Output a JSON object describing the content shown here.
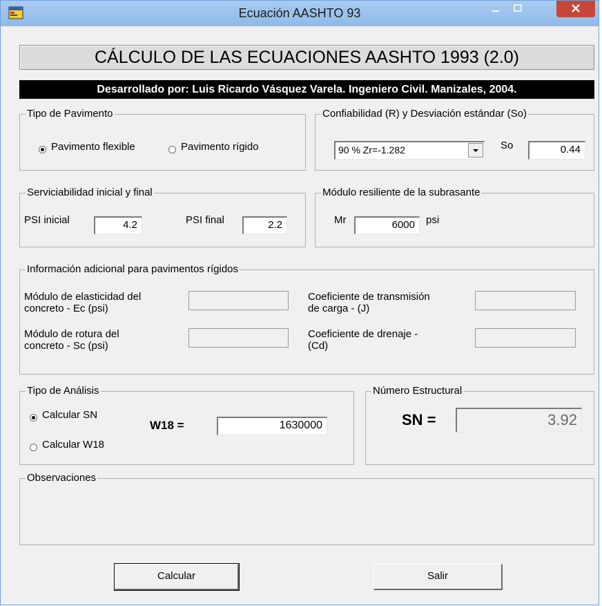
{
  "window": {
    "title": "Ecuación AASHTO 93"
  },
  "header": {
    "main_title": "CÁLCULO DE LAS ECUACIONES AASHTO 1993 (2.0)",
    "credit": "Desarrollado por: Luis Ricardo Vásquez Varela.  Ingeniero Civil. Manizales, 2004."
  },
  "pavement_type": {
    "legend": "Tipo de Pavimento",
    "flexible": "Pavimento flexible",
    "rigid": "Pavimento rígido",
    "selected": "flexible"
  },
  "reliability": {
    "legend": "Confiabilidad (R) y Desviación estándar (So)",
    "selected": "90 %  Zr=-1.282",
    "so_label": "So",
    "so_value": "0.44"
  },
  "serviceability": {
    "legend": "Serviciabilidad inicial y final",
    "psi_initial_label": "PSI inicial",
    "psi_initial_value": "4.2",
    "psi_final_label": "PSI final",
    "psi_final_value": "2.2"
  },
  "modulus": {
    "legend": "Módulo resiliente de la subrasante",
    "mr_label": "Mr",
    "mr_value": "6000",
    "unit": "psi"
  },
  "rigid_info": {
    "legend": "Información adicional para pavimentos rígidos",
    "ec_label_1": "Módulo de elasticidad del",
    "ec_label_2": "concreto - Ec (psi)",
    "sc_label_1": "Módulo de rotura del",
    "sc_label_2": "concreto - Sc (psi)",
    "j_label_1": "Coeficiente de transmisión",
    "j_label_2": "de carga - (J)",
    "cd_label_1": "Coeficiente de drenaje -",
    "cd_label_2": "(Cd)"
  },
  "analysis": {
    "legend": "Tipo de Análisis",
    "calc_sn": "Calcular SN",
    "calc_w18": "Calcular W18",
    "selected": "sn",
    "w18_label": "W18 =",
    "w18_value": "1630000"
  },
  "structural": {
    "legend": "Número Estructural",
    "sn_label": "SN =",
    "sn_value": "3.92"
  },
  "observations": {
    "legend": "Observaciones"
  },
  "buttons": {
    "calculate": "Calcular",
    "exit": "Salir"
  },
  "colors": {
    "close_button": "#c7463a",
    "title_bar": "#9cc3ec",
    "credit_bar": "#000000"
  }
}
